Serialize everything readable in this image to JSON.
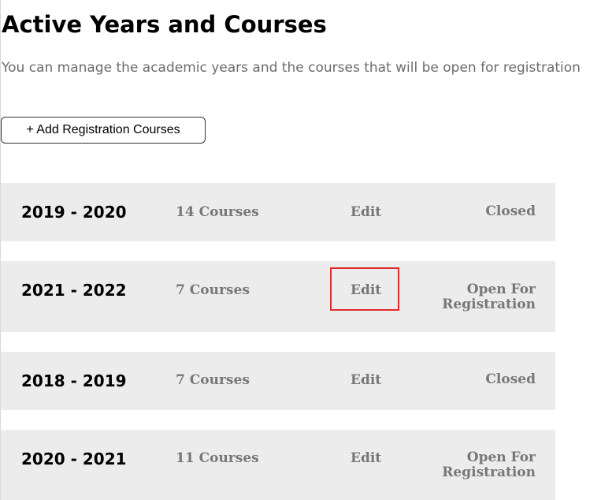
{
  "page": {
    "title": "Active Years and Courses",
    "subtitle": "You can manage the academic years and the courses that will be open for registration"
  },
  "toolbar": {
    "add_button_label": "+ Add Registration Courses"
  },
  "years": [
    {
      "year": "2019 - 2020",
      "courses": "14 Courses",
      "edit_label": "Edit",
      "status": "Closed"
    },
    {
      "year": "2021 - 2022",
      "courses": "7 Courses",
      "edit_label": "Edit",
      "status": "Open For Registration"
    },
    {
      "year": "2018 - 2019",
      "courses": "7 Courses",
      "edit_label": "Edit",
      "status": "Closed"
    },
    {
      "year": "2020 - 2021",
      "courses": "11 Courses",
      "edit_label": "Edit",
      "status": "Open For Registration"
    }
  ],
  "colors": {
    "row_background": "#ececec",
    "muted_text": "#777777",
    "highlight": "#e02b2b"
  }
}
